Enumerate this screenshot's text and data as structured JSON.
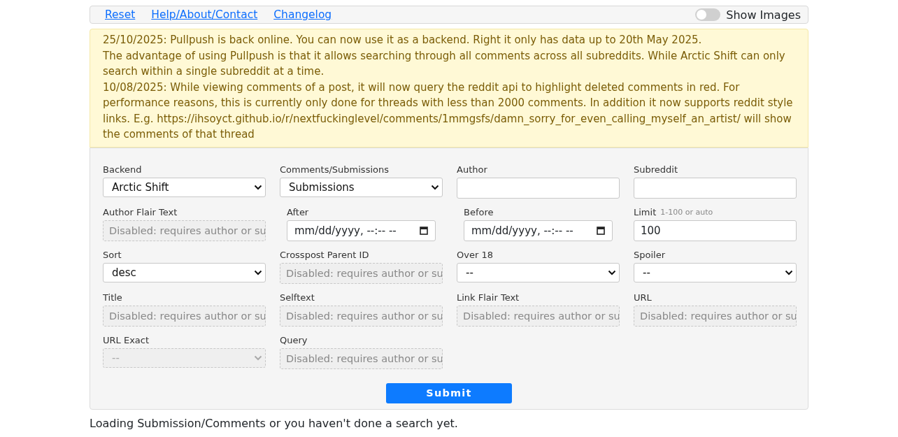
{
  "nav": {
    "links": [
      "Reset",
      "Help/About/Contact",
      "Changelog"
    ],
    "toggle": {
      "label": "Show Images",
      "on": false
    }
  },
  "notice": [
    "25/10/2025: Pullpush is back online. You can now use it as a backend. Right it only has data up to 20th May 2025.",
    "The advantage of using Pullpush is that it allows searching through all comments across all subreddits. While Arctic Shift can only search within a single subreddit at a time.",
    "10/08/2025: While viewing comments of a post, it will now query the reddit api to highlight deleted comments in red. For performance reasons, this is currently only done for threads with less than 2000 comments. In addition it now supports reddit style links. E.g. https://ihsoyct.github.io/r/nextfuckinglevel/comments/1mmgsfs/damn_sorry_for_even_calling_myself_an_artist/ will show the comments of that thread"
  ],
  "form": {
    "fields": [
      {
        "label": "Backend",
        "kind": "select",
        "value": "Arctic Shift",
        "disabled": false
      },
      {
        "label": "Comments/Submissions",
        "kind": "select",
        "value": "Submissions",
        "disabled": false
      },
      {
        "label": "Author",
        "kind": "text",
        "disabled": false
      },
      {
        "label": "Subreddit",
        "kind": "text",
        "disabled": false
      },
      {
        "label": "Author Flair Text",
        "kind": "text",
        "placeholder": "Disabled: requires author or su",
        "disabled": true
      },
      {
        "label": "After",
        "kind": "date",
        "placeholder": "mm/dd/yyyy, --:-- --",
        "disabled": false
      },
      {
        "label": "Before",
        "kind": "date",
        "placeholder": "mm/dd/yyyy, --:-- --",
        "disabled": false
      },
      {
        "label": "Limit",
        "hint": "1-100 or auto",
        "kind": "text",
        "value": "100",
        "disabled": false
      },
      {
        "label": "Sort",
        "kind": "select",
        "value": "desc",
        "disabled": false
      },
      {
        "label": "Crosspost Parent ID",
        "kind": "text",
        "placeholder": "Disabled: requires author or su",
        "disabled": true
      },
      {
        "label": "Over 18",
        "kind": "select",
        "value": "--",
        "disabled": false
      },
      {
        "label": "Spoiler",
        "kind": "select",
        "value": "--",
        "disabled": false
      },
      {
        "label": "Title",
        "kind": "text",
        "placeholder": "Disabled: requires author or su",
        "disabled": true
      },
      {
        "label": "Selftext",
        "kind": "text",
        "placeholder": "Disabled: requires author or su",
        "disabled": true
      },
      {
        "label": "Link Flair Text",
        "kind": "text",
        "placeholder": "Disabled: requires author or su",
        "disabled": true
      },
      {
        "label": "URL",
        "kind": "text",
        "placeholder": "Disabled: requires author or su",
        "disabled": true
      },
      {
        "label": "URL Exact",
        "kind": "select",
        "value": "--",
        "disabled": true
      },
      {
        "label": "Query",
        "kind": "text",
        "placeholder": "Disabled: requires author or su",
        "disabled": true
      }
    ],
    "submit": "Submit"
  },
  "status": "Loading Submission/Comments or you haven't done a search yet."
}
